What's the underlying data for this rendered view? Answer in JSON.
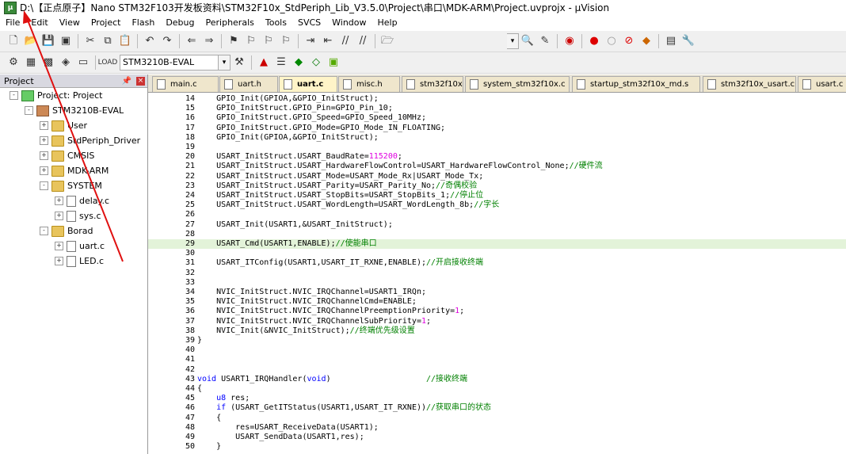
{
  "window": {
    "title": "D:\\【正点原子】Nano STM32F103开发板资料\\STM32F10x_StdPeriph_Lib_V3.5.0\\Project\\串口\\MDK-ARM\\Project.uvprojx - µVision",
    "icon": "uvision-icon"
  },
  "menu": [
    "File",
    "Edit",
    "View",
    "Project",
    "Flash",
    "Debug",
    "Peripherals",
    "Tools",
    "SVCS",
    "Window",
    "Help"
  ],
  "toolbar2": {
    "target": "STM3210B-EVAL"
  },
  "project_panel": {
    "title": "Project",
    "tree": [
      {
        "label": "Project: Project",
        "level": 0,
        "icon": "root",
        "expander": "-"
      },
      {
        "label": "STM3210B-EVAL",
        "level": 1,
        "icon": "target",
        "expander": "-"
      },
      {
        "label": "User",
        "level": 2,
        "icon": "folder",
        "expander": "+"
      },
      {
        "label": "StdPeriph_Driver",
        "level": 2,
        "icon": "folder",
        "expander": "+"
      },
      {
        "label": "CMSIS",
        "level": 2,
        "icon": "folder",
        "expander": "+"
      },
      {
        "label": "MDK-ARM",
        "level": 2,
        "icon": "folder",
        "expander": "+"
      },
      {
        "label": "SYSTEM",
        "level": 2,
        "icon": "folder",
        "expander": "-"
      },
      {
        "label": "delay.c",
        "level": 3,
        "icon": "file",
        "expander": "+"
      },
      {
        "label": "sys.c",
        "level": 3,
        "icon": "file",
        "expander": "+"
      },
      {
        "label": "Borad",
        "level": 2,
        "icon": "folder",
        "expander": "-"
      },
      {
        "label": "uart.c",
        "level": 3,
        "icon": "file",
        "expander": "+"
      },
      {
        "label": "LED.c",
        "level": 3,
        "icon": "file",
        "expander": "+"
      }
    ]
  },
  "tabs": [
    {
      "label": "main.c",
      "active": false
    },
    {
      "label": "uart.h",
      "active": false
    },
    {
      "label": "uart.c",
      "active": true
    },
    {
      "label": "misc.h",
      "active": false
    },
    {
      "label": "stm32f10x.h",
      "active": false
    },
    {
      "label": "system_stm32f10x.c",
      "active": false
    },
    {
      "label": "startup_stm32f10x_md.s",
      "active": false
    },
    {
      "label": "stm32f10x_usart.c",
      "active": false
    },
    {
      "label": "usart.c",
      "active": false
    }
  ],
  "code_lines": [
    {
      "n": "14",
      "code": "    GPIO_Init(GPIOA,&GPIO_InitStruct);"
    },
    {
      "n": "15",
      "code": "    GPIO_InitStruct.GPIO_Pin=GPIO_Pin_10;"
    },
    {
      "n": "16",
      "code": "    GPIO_InitStruct.GPIO_Speed=GPIO_Speed_10MHz;"
    },
    {
      "n": "17",
      "code": "    GPIO_InitStruct.GPIO_Mode=GPIO_Mode_IN_FLOATING;"
    },
    {
      "n": "18",
      "code": "    GPIO_Init(GPIOA,&GPIO_InitStruct);"
    },
    {
      "n": "19",
      "code": ""
    },
    {
      "n": "20",
      "code": "    USART_InitStruct.USART_BaudRate=",
      "num": "115200",
      "tail": ";"
    },
    {
      "n": "21",
      "code": "    USART_InitStruct.USART_HardwareFlowControl=USART_HardwareFlowControl_None;",
      "comment": "//硬件流"
    },
    {
      "n": "22",
      "code": "    USART_InitStruct.USART_Mode=USART_Mode_Rx|USART_Mode_Tx;"
    },
    {
      "n": "23",
      "code": "    USART_InitStruct.USART_Parity=USART_Parity_No;",
      "comment": "//奇偶校验"
    },
    {
      "n": "24",
      "code": "    USART_InitStruct.USART_StopBits=USART_StopBits_1;",
      "comment": "//停止位"
    },
    {
      "n": "25",
      "code": "    USART_InitStruct.USART_WordLength=USART_WordLength_8b;",
      "comment": "//字长"
    },
    {
      "n": "26",
      "code": ""
    },
    {
      "n": "27",
      "code": "    USART_Init(USART1,&USART_InitStruct);"
    },
    {
      "n": "28",
      "code": ""
    },
    {
      "n": "29",
      "code": "    USART_Cmd(USART1,ENABLE);",
      "comment": "//使能串口",
      "highlight": true
    },
    {
      "n": "30",
      "code": ""
    },
    {
      "n": "31",
      "code": "    USART_ITConfig(USART1,USART_IT_RXNE,ENABLE);",
      "comment": "//开启接收终端"
    },
    {
      "n": "32",
      "code": ""
    },
    {
      "n": "33",
      "code": ""
    },
    {
      "n": "34",
      "code": "    NVIC_InitStruct.NVIC_IRQChannel=USART1_IRQn;"
    },
    {
      "n": "35",
      "code": "    NVIC_InitStruct.NVIC_IRQChannelCmd=ENABLE;"
    },
    {
      "n": "36",
      "code": "    NVIC_InitStruct.NVIC_IRQChannelPreemptionPriority=",
      "num": "1",
      "tail": ";"
    },
    {
      "n": "37",
      "code": "    NVIC_InitStruct.NVIC_IRQChannelSubPriority=",
      "num": "1",
      "tail": ";"
    },
    {
      "n": "38",
      "code": "    NVIC_Init(&NVIC_InitStruct);",
      "comment": "//终端优先级设置"
    },
    {
      "n": "39",
      "code": "}"
    },
    {
      "n": "40",
      "code": ""
    },
    {
      "n": "41",
      "code": ""
    },
    {
      "n": "42",
      "code": ""
    },
    {
      "n": "43",
      "kw": "void",
      "code": " USART1_IRQHandler(",
      "kw2": "void",
      "tail": ")",
      "comment": "                    //接收终端"
    },
    {
      "n": "44",
      "code": "{"
    },
    {
      "n": "45",
      "code": "    ",
      "kw": "u8",
      "tail": " res;"
    },
    {
      "n": "46",
      "code": "    ",
      "kw": "if",
      "tail": " (USART_GetITStatus(USART1,USART_IT_RXNE))",
      "comment": "//获取串口的状态"
    },
    {
      "n": "47",
      "code": "    {"
    },
    {
      "n": "48",
      "code": "        res=USART_ReceiveData(USART1);"
    },
    {
      "n": "49",
      "code": "        USART_SendData(USART1,res);"
    },
    {
      "n": "50",
      "code": "    }"
    }
  ]
}
